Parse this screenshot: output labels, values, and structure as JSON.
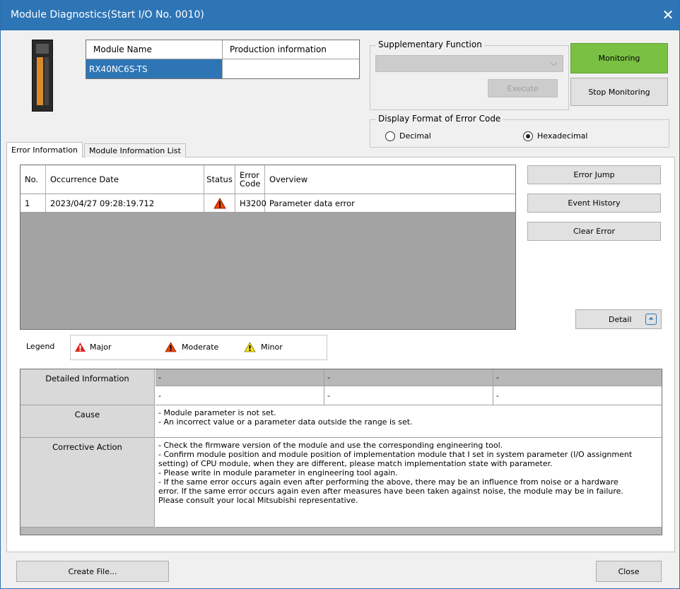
{
  "window": {
    "title": "Module Diagnostics(Start I/O No. 0010)",
    "close_glyph": "✕"
  },
  "module_table": {
    "col_module_name": "Module Name",
    "col_production_info": "Production information",
    "module_name": "RX40NC6S-TS",
    "production_info": ""
  },
  "supplementary": {
    "label": "Supplementary Function",
    "selected": "",
    "execute_label": "Execute"
  },
  "monitoring": {
    "monitoring_label": "Monitoring",
    "stop_label": "Stop Monitoring",
    "monitoring_color": "#7ac143"
  },
  "error_code_format": {
    "label": "Display Format of Error Code",
    "decimal_label": "Decimal",
    "hexadecimal_label": "Hexadecimal",
    "selected": "Hexadecimal"
  },
  "tabs": [
    {
      "label": "Error Information",
      "active": true
    },
    {
      "label": "Module Information List",
      "active": false
    }
  ],
  "error_list": {
    "headers": {
      "no": "No.",
      "date": "Occurrence Date",
      "status": "Status",
      "code_line1": "Error",
      "code_line2": "Code",
      "overview": "Overview"
    },
    "rows": [
      {
        "no": "1",
        "date": "2023/04/27 09:28:19.712",
        "status": "major",
        "code": "H3200",
        "overview": "Parameter data error"
      }
    ]
  },
  "side_buttons": {
    "error_jump": "Error Jump",
    "event_history": "Event History",
    "clear_error": "Clear Error",
    "detail": "Detail"
  },
  "legend": {
    "label": "Legend",
    "major": "Major",
    "moderate": "Moderate",
    "minor": "Minor",
    "major_color": "#d9261c",
    "moderate_color": "#e8440a",
    "minor_color": "#f5e11b"
  },
  "details": {
    "detailed_info_label": "Detailed Information",
    "detailed_info_row1": [
      "-",
      "-",
      "-"
    ],
    "detailed_info_row2": [
      "-",
      "-",
      "-"
    ],
    "cause_label": "Cause",
    "cause_lines": [
      "- Module parameter is not set.",
      "- An incorrect value or a parameter data outside the range is set."
    ],
    "corrective_label": "Corrective Action",
    "corrective_lines": [
      "- Check the firmware version of the module and use the corresponding engineering tool.",
      "- Confirm module position and module position of implementation module that I set in system parameter (I/O assignment",
      "setting) of CPU module, when they are different, please match implementation state with parameter.",
      "- Please write in module parameter in engineering tool again.",
      "- If the same error occurs again even after performing the above, there may be an influence from noise or a hardware",
      "error. If the same error occurs again even after measures have been taken against noise, the module may be in failure.",
      "Please consult your local Mitsubishi representative."
    ]
  },
  "footer": {
    "create_file": "Create File...",
    "close": "Close"
  }
}
